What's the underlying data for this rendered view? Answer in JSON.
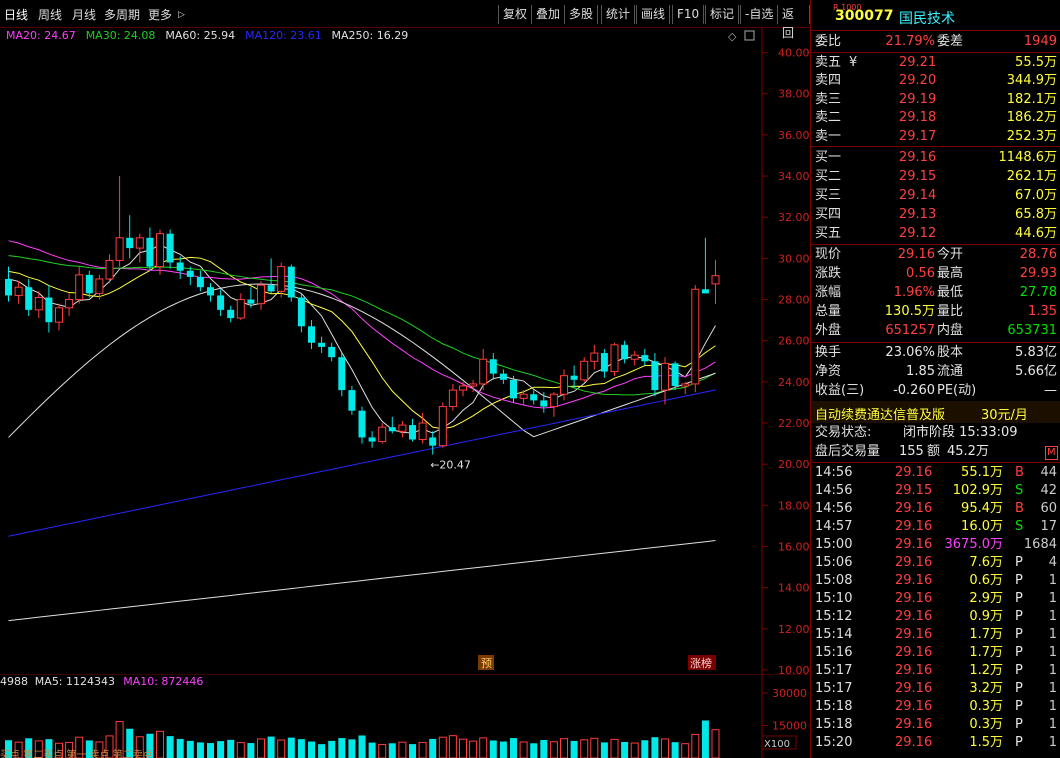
{
  "toolbar": {
    "periods": [
      "日线",
      "周线",
      "月线",
      "多周期",
      "更多"
    ],
    "tools": [
      "复权",
      "叠加",
      "多股",
      "统计",
      "画线",
      "F10",
      "标记",
      "-自选",
      "返回"
    ]
  },
  "ma_legend": [
    {
      "label": "MA20: 24.67",
      "color": "#ff40ff"
    },
    {
      "label": "MA30: 24.08",
      "color": "#20d020"
    },
    {
      "label": "MA60: 25.94",
      "color": "#e0e0e0"
    },
    {
      "label": "MA120: 23.61",
      "color": "#2828ff"
    },
    {
      "label": "MA250: 16.29",
      "color": "#e0e0e0"
    }
  ],
  "price_axis": [
    "40.00",
    "38.00",
    "36.00",
    "34.00",
    "32.00",
    "30.00",
    "28.00",
    "26.00",
    "24.00",
    "22.00",
    "20.00",
    "18.00",
    "16.00",
    "14.00",
    "12.00",
    "10.00"
  ],
  "low_marker": "←20.47",
  "chart_tags": {
    "yu": "预",
    "zhangbang": "涨榜"
  },
  "vol_legend": [
    {
      "label": "4988",
      "color": "#e0e0e0"
    },
    {
      "label": "MA5: 1124343",
      "color": "#e0e0e0"
    },
    {
      "label": "MA10: 872446",
      "color": "#ff40ff"
    }
  ],
  "vol_axis": [
    "30000",
    "15000"
  ],
  "vol_unit": "X100",
  "bottom_tags": "买点 第二买点 第一 卖点 第二卖点",
  "chart_data": {
    "type": "candlestick",
    "y_range": [
      10,
      41
    ],
    "candles": [
      [
        29.0,
        29.6,
        27.9,
        28.2
      ],
      [
        28.2,
        28.9,
        27.8,
        28.6
      ],
      [
        28.6,
        29.0,
        27.2,
        27.5
      ],
      [
        27.5,
        28.4,
        27.1,
        28.1
      ],
      [
        28.1,
        28.7,
        26.4,
        26.9
      ],
      [
        26.9,
        27.8,
        26.5,
        27.6
      ],
      [
        27.6,
        28.3,
        27.2,
        28.0
      ],
      [
        28.0,
        29.6,
        27.8,
        29.2
      ],
      [
        29.2,
        29.4,
        28.1,
        28.3
      ],
      [
        28.3,
        29.2,
        28.0,
        29.0
      ],
      [
        29.0,
        30.2,
        28.8,
        29.9
      ],
      [
        29.9,
        34.0,
        29.6,
        31.0
      ],
      [
        31.0,
        32.1,
        30.0,
        30.5
      ],
      [
        30.5,
        31.2,
        29.8,
        31.0
      ],
      [
        31.0,
        31.5,
        29.4,
        29.6
      ],
      [
        29.6,
        31.4,
        29.2,
        31.2
      ],
      [
        31.2,
        31.4,
        29.5,
        29.8
      ],
      [
        29.8,
        30.1,
        29.0,
        29.4
      ],
      [
        29.4,
        29.6,
        28.7,
        29.1
      ],
      [
        29.1,
        29.4,
        28.4,
        28.6
      ],
      [
        28.6,
        28.8,
        27.9,
        28.2
      ],
      [
        28.2,
        28.5,
        27.2,
        27.5
      ],
      [
        27.5,
        27.7,
        26.9,
        27.1
      ],
      [
        27.1,
        28.3,
        27.0,
        28.0
      ],
      [
        28.0,
        28.6,
        27.6,
        27.8
      ],
      [
        27.8,
        28.9,
        27.5,
        28.7
      ],
      [
        28.7,
        30.0,
        28.3,
        28.4
      ],
      [
        28.4,
        29.8,
        28.1,
        29.6
      ],
      [
        29.6,
        29.7,
        27.9,
        28.1
      ],
      [
        28.1,
        28.3,
        26.4,
        26.7
      ],
      [
        26.7,
        27.0,
        25.6,
        25.9
      ],
      [
        25.9,
        26.2,
        25.4,
        25.7
      ],
      [
        25.7,
        25.9,
        25.0,
        25.2
      ],
      [
        25.2,
        25.4,
        23.3,
        23.6
      ],
      [
        23.6,
        23.8,
        22.4,
        22.6
      ],
      [
        22.6,
        22.8,
        21.0,
        21.3
      ],
      [
        21.3,
        21.6,
        20.8,
        21.1
      ],
      [
        21.1,
        22.0,
        21.0,
        21.8
      ],
      [
        21.8,
        22.3,
        21.5,
        21.6
      ],
      [
        21.6,
        22.1,
        21.3,
        21.9
      ],
      [
        21.9,
        22.2,
        21.1,
        21.2
      ],
      [
        21.2,
        22.5,
        21.0,
        22.0
      ],
      [
        21.3,
        21.6,
        20.47,
        20.9
      ],
      [
        20.9,
        23.0,
        20.8,
        22.8
      ],
      [
        22.8,
        23.9,
        22.6,
        23.6
      ],
      [
        23.6,
        24.0,
        23.3,
        23.8
      ],
      [
        23.8,
        24.1,
        23.5,
        23.9
      ],
      [
        23.9,
        25.6,
        23.6,
        25.1
      ],
      [
        25.1,
        25.4,
        24.1,
        24.4
      ],
      [
        24.4,
        24.6,
        23.9,
        24.1
      ],
      [
        24.1,
        24.3,
        23.0,
        23.2
      ],
      [
        23.2,
        23.6,
        22.9,
        23.4
      ],
      [
        23.4,
        23.6,
        22.9,
        23.1
      ],
      [
        23.1,
        23.5,
        22.5,
        22.8
      ],
      [
        22.8,
        23.5,
        22.3,
        23.4
      ],
      [
        23.4,
        24.6,
        23.1,
        24.3
      ],
      [
        24.3,
        24.8,
        23.7,
        24.1
      ],
      [
        24.1,
        25.2,
        24.0,
        25.0
      ],
      [
        25.0,
        25.8,
        24.6,
        25.4
      ],
      [
        25.4,
        25.6,
        24.2,
        24.5
      ],
      [
        24.5,
        25.9,
        24.3,
        25.8
      ],
      [
        25.8,
        26.0,
        24.9,
        25.1
      ],
      [
        25.1,
        25.5,
        24.8,
        25.3
      ],
      [
        25.3,
        25.6,
        24.8,
        25.0
      ],
      [
        25.0,
        25.4,
        23.3,
        23.6
      ],
      [
        23.6,
        25.2,
        22.9,
        24.9
      ],
      [
        24.9,
        25.0,
        23.6,
        23.8
      ],
      [
        23.8,
        24.0,
        23.4,
        23.9
      ],
      [
        23.9,
        28.7,
        23.5,
        28.5
      ],
      [
        28.5,
        31.0,
        28.3,
        28.3
      ],
      [
        28.76,
        29.93,
        27.78,
        29.16
      ]
    ],
    "volumes": [
      8200,
      7300,
      9100,
      7900,
      8700,
      6800,
      7200,
      9600,
      8100,
      7400,
      10200,
      16800,
      13500,
      9800,
      11200,
      12300,
      10100,
      8800,
      7900,
      7200,
      6900,
      7800,
      8400,
      7100,
      6900,
      8800,
      9900,
      8300,
      9400,
      8700,
      7600,
      6400,
      7900,
      9200,
      8600,
      10400,
      7100,
      6200,
      6800,
      7300,
      6400,
      7200,
      8800,
      9600,
      10300,
      8700,
      7800,
      9300,
      8100,
      7600,
      9200,
      7400,
      6800,
      8300,
      7500,
      8900,
      7900,
      8400,
      9100,
      7200,
      8600,
      7400,
      6900,
      8200,
      9600,
      8800,
      7300,
      6600,
      10900,
      17300,
      13050
    ]
  },
  "quote": {
    "code": "300077",
    "name": "国民技术",
    "badge": "R 1000",
    "weibi_label": "委比",
    "weibi": "21.79%",
    "weicha_label": "委差",
    "weicha": "1949",
    "asks": [
      {
        "label": "卖五",
        "mark": "¥",
        "price": "29.21",
        "vol": "55.5万"
      },
      {
        "label": "卖四",
        "mark": "",
        "price": "29.20",
        "vol": "344.9万"
      },
      {
        "label": "卖三",
        "mark": "",
        "price": "29.19",
        "vol": "182.1万"
      },
      {
        "label": "卖二",
        "mark": "",
        "price": "29.18",
        "vol": "186.2万"
      },
      {
        "label": "卖一",
        "mark": "",
        "price": "29.17",
        "vol": "252.3万"
      }
    ],
    "bids": [
      {
        "label": "买一",
        "price": "29.16",
        "vol": "1148.6万"
      },
      {
        "label": "买二",
        "price": "29.15",
        "vol": "262.1万"
      },
      {
        "label": "买三",
        "price": "29.14",
        "vol": "67.0万"
      },
      {
        "label": "买四",
        "price": "29.13",
        "vol": "65.8万"
      },
      {
        "label": "买五",
        "price": "29.12",
        "vol": "44.6万"
      }
    ],
    "stats": [
      {
        "l1": "现价",
        "v1": "29.16",
        "c1": "red",
        "l2": "今开",
        "v2": "28.76",
        "c2": "red"
      },
      {
        "l1": "涨跌",
        "v1": "0.56",
        "c1": "red",
        "l2": "最高",
        "v2": "29.93",
        "c2": "red"
      },
      {
        "l1": "涨幅",
        "v1": "1.96%",
        "c1": "red",
        "l2": "最低",
        "v2": "27.78",
        "c2": "green"
      },
      {
        "l1": "总量",
        "v1": "130.5万",
        "c1": "yellow",
        "l2": "量比",
        "v2": "1.35",
        "c2": "red"
      },
      {
        "l1": "外盘",
        "v1": "651257",
        "c1": "red",
        "l2": "内盘",
        "v2": "653731",
        "c2": "green"
      }
    ],
    "fund": [
      {
        "l1": "换手",
        "v1": "23.06%",
        "l2": "股本",
        "v2": "5.83亿"
      },
      {
        "l1": "净资",
        "v1": "1.85",
        "l2": "流通",
        "v2": "5.66亿"
      },
      {
        "l1": "收益(三)",
        "v1": "-0.260",
        "l2": "PE(动)",
        "v2": "—"
      }
    ],
    "promo": "自动续费通达信普及版",
    "promo_price": "30元/月",
    "trade_state_label": "交易状态:",
    "trade_state": "闭市阶段 15:33:09",
    "after_label": "盘后交易量",
    "after_vol": "155",
    "after_amt_label": "额",
    "after_amt": "45.2万",
    "after_badge": "M"
  },
  "ticks": [
    {
      "t": "14:56",
      "p": "29.16",
      "v": "55.1万",
      "vc": "yellow",
      "bs": "B",
      "bc": "red",
      "n": "44"
    },
    {
      "t": "14:56",
      "p": "29.15",
      "v": "102.9万",
      "vc": "yellow",
      "bs": "S",
      "bc": "green",
      "n": "42"
    },
    {
      "t": "14:56",
      "p": "29.16",
      "v": "95.4万",
      "vc": "yellow",
      "bs": "B",
      "bc": "red",
      "n": "60"
    },
    {
      "t": "14:57",
      "p": "29.16",
      "v": "16.0万",
      "vc": "yellow",
      "bs": "S",
      "bc": "green",
      "n": "17"
    },
    {
      "t": "15:00",
      "p": "29.16",
      "v": "3675.0万",
      "vc": "mag",
      "bs": "",
      "bc": "white",
      "n": "1684"
    },
    {
      "t": "15:06",
      "p": "29.16",
      "v": "7.6万",
      "vc": "yellow",
      "bs": "P",
      "bc": "white",
      "n": "4"
    },
    {
      "t": "15:08",
      "p": "29.16",
      "v": "0.6万",
      "vc": "yellow",
      "bs": "P",
      "bc": "white",
      "n": "1"
    },
    {
      "t": "15:10",
      "p": "29.16",
      "v": "2.9万",
      "vc": "yellow",
      "bs": "P",
      "bc": "white",
      "n": "1"
    },
    {
      "t": "15:12",
      "p": "29.16",
      "v": "0.9万",
      "vc": "yellow",
      "bs": "P",
      "bc": "white",
      "n": "1"
    },
    {
      "t": "15:14",
      "p": "29.16",
      "v": "1.7万",
      "vc": "yellow",
      "bs": "P",
      "bc": "white",
      "n": "1"
    },
    {
      "t": "15:16",
      "p": "29.16",
      "v": "1.7万",
      "vc": "yellow",
      "bs": "P",
      "bc": "white",
      "n": "1"
    },
    {
      "t": "15:17",
      "p": "29.16",
      "v": "1.2万",
      "vc": "yellow",
      "bs": "P",
      "bc": "white",
      "n": "1"
    },
    {
      "t": "15:17",
      "p": "29.16",
      "v": "3.2万",
      "vc": "yellow",
      "bs": "P",
      "bc": "white",
      "n": "1"
    },
    {
      "t": "15:18",
      "p": "29.16",
      "v": "0.3万",
      "vc": "yellow",
      "bs": "P",
      "bc": "white",
      "n": "1"
    },
    {
      "t": "15:18",
      "p": "29.16",
      "v": "0.3万",
      "vc": "yellow",
      "bs": "P",
      "bc": "white",
      "n": "1"
    },
    {
      "t": "15:20",
      "p": "29.16",
      "v": "1.5万",
      "vc": "yellow",
      "bs": "P",
      "bc": "white",
      "n": "1"
    }
  ],
  "colors": {
    "up": "#ff3c3c",
    "down": "#00e8e8",
    "grid": "#5a0000",
    "ma5": "#e0e0e0",
    "ma10": "#ffff3c",
    "ma20": "#ff40ff",
    "ma30": "#20d020",
    "ma60": "#e0e0e0",
    "ma120": "#2828ff",
    "ma250": "#e0e0e0"
  }
}
